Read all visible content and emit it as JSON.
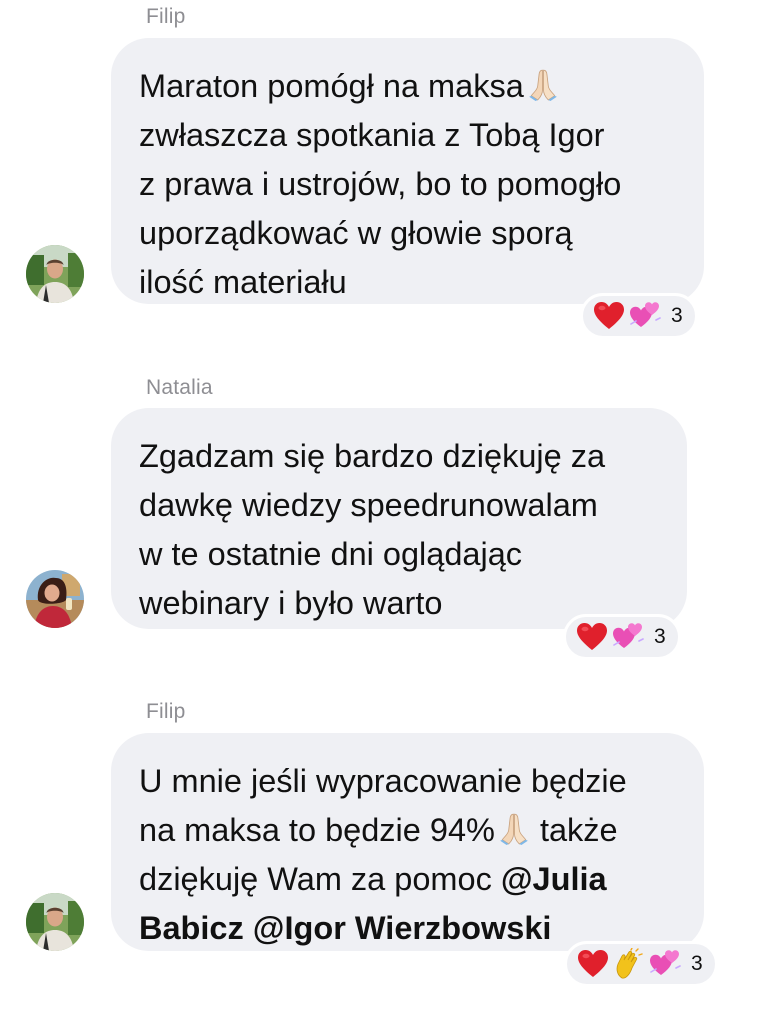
{
  "messages": [
    {
      "sender": "Filip",
      "lines": [
        "Maraton pomógł na maksa",
        "zwłaszcza spotkania z Tobą Igor",
        "z prawa i ustrojów, bo to pomogło",
        "uporządkować w głowie sporą",
        "ilość materiału"
      ],
      "reactions": [
        "red-heart",
        "two-hearts"
      ],
      "reaction_count": "3"
    },
    {
      "sender": "Natalia",
      "lines": [
        "Zgadzam się bardzo dziękuję za",
        "dawkę wiedzy speedrunowalam",
        "w te ostatnie dni oglądając",
        "webinary i było warto"
      ],
      "reactions": [
        "red-heart",
        "two-hearts"
      ],
      "reaction_count": "3"
    },
    {
      "sender": "Filip",
      "line1": "U mnie jeśli wypracowanie będzie",
      "line2_before": "na maksa to będzie 94%",
      "line2_after": " także",
      "line3_before": "dziękuję Wam za pomoc ",
      "mention1": "@Julia",
      "mention1_cont": "Babicz",
      "mention2": " @Igor Wierzbowski",
      "reactions": [
        "red-heart",
        "clapping-hands",
        "two-hearts"
      ],
      "reaction_count": "3"
    }
  ],
  "colors": {
    "bubble": "#eff0f4",
    "sender_name": "#8e8e93",
    "text": "#111111",
    "heart": "#e0202c",
    "two_hearts": "#e94fb5"
  }
}
